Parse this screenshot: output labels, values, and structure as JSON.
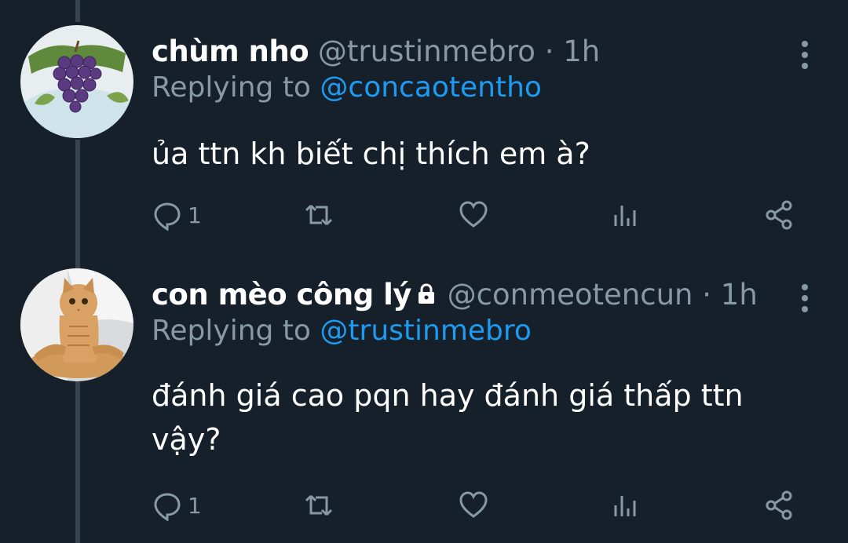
{
  "tweets": [
    {
      "name": "chùm nho",
      "handle": "@trustinmebro",
      "sep": "·",
      "time": "1h",
      "replying_prefix": "Replying to ",
      "replying_to": "@concaotentho",
      "text": "ủa ttn kh biết chị thích em à?",
      "reply_count": "1",
      "avatar_icon": "grapes-avatar"
    },
    {
      "name": "con mèo công lý",
      "handle": "@conmeotencun",
      "sep": "·",
      "time": "1h",
      "replying_prefix": "Replying to ",
      "replying_to": "@trustinmebro",
      "text_line1": "đánh giá cao pqn hay đánh giá thấp ttn",
      "text_line2": "vậy?",
      "reply_count": "1",
      "avatar_icon": "cat-avatar",
      "protected_icon": "lock-icon"
    }
  ],
  "colors": {
    "background": "#15202b",
    "secondary_text": "#8899a6",
    "link": "#1d9bf0",
    "thread_line": "#38444d"
  }
}
